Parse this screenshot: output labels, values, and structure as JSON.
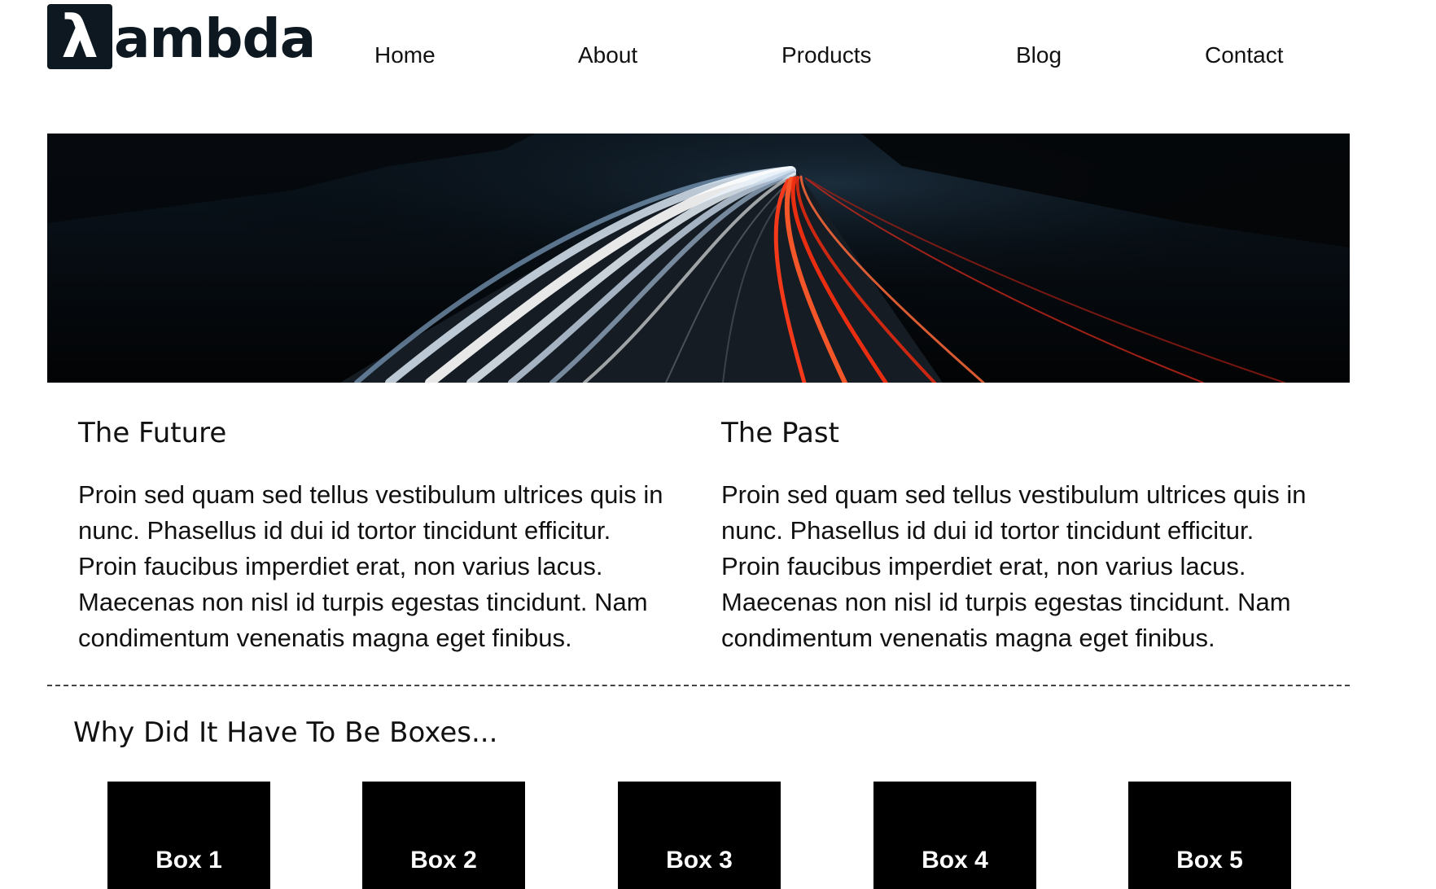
{
  "brand": {
    "symbol": "λ",
    "wordmark": "ambda"
  },
  "nav": [
    "Home",
    "About",
    "Products",
    "Blog",
    "Contact"
  ],
  "hero": {
    "image": "night-highway-light-trails"
  },
  "columns": [
    {
      "title": "The Future",
      "body": "Proin sed quam sed tellus vestibulum ultrices quis in nunc. Phasellus id dui id tortor tincidunt efficitur. Proin faucibus imperdiet erat, non varius lacus. Maecenas non nisl id turpis egestas tincidunt. Nam condimentum venenatis magna eget finibus."
    },
    {
      "title": "The Past",
      "body": "Proin sed quam sed tellus vestibulum ultrices quis in nunc. Phasellus id dui id tortor tincidunt efficitur. Proin faucibus imperdiet erat, non varius lacus. Maecenas non nisl id turpis egestas tincidunt. Nam condimentum venenatis magna eget finibus."
    }
  ],
  "boxes_section": {
    "title": "Why Did It Have To Be Boxes...",
    "boxes": [
      "Box 1",
      "Box 2",
      "Box 3",
      "Box 4",
      "Box 5"
    ]
  },
  "colors": {
    "box_bg": "#000000",
    "text": "#111111",
    "logo": "#0d1820"
  }
}
